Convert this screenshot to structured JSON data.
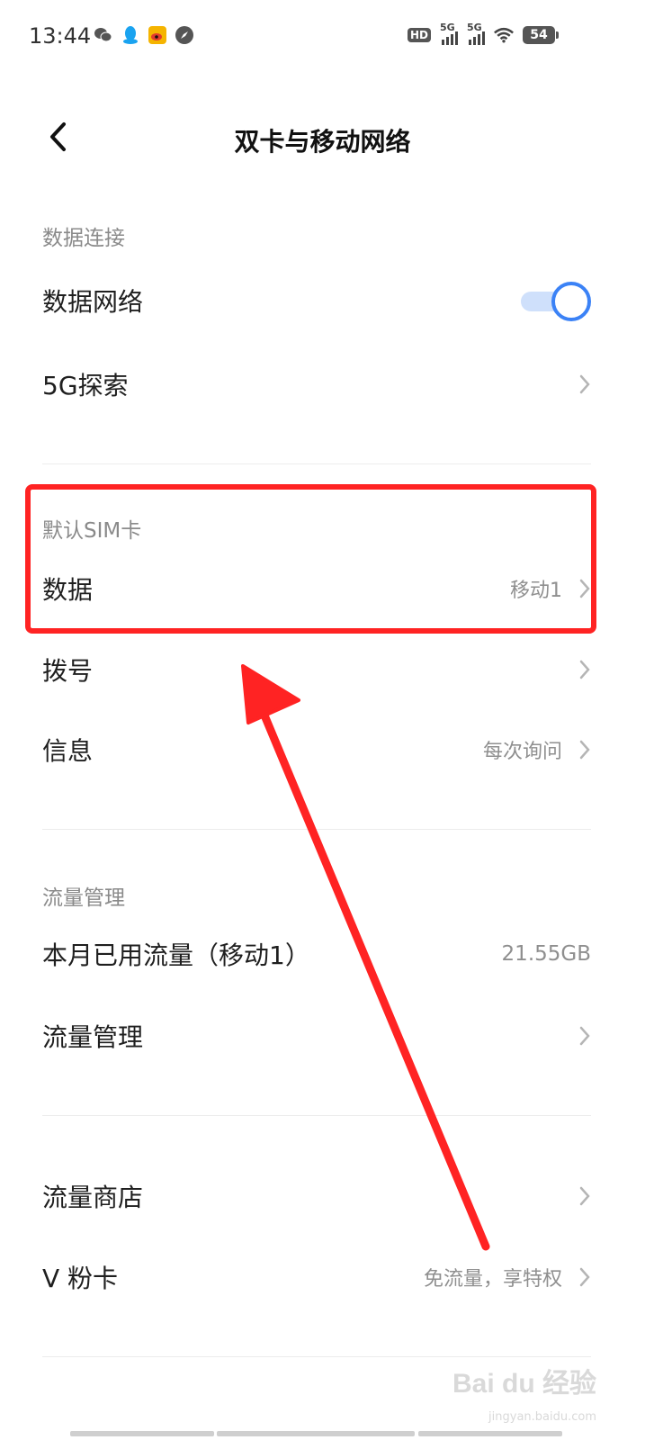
{
  "status_bar": {
    "time": "13:44",
    "battery": "54",
    "hd_label": "HD",
    "network1": "5G",
    "network2": "5G",
    "left_icons": [
      "wechat-icon",
      "qq-icon",
      "weibo-icon",
      "compass-icon"
    ]
  },
  "header": {
    "title": "双卡与移动网络"
  },
  "sections": {
    "data_connection": {
      "title": "数据连接",
      "data_network_label": "数据网络",
      "data_network_on": true,
      "fiveg_label": "5G探索"
    },
    "default_sim": {
      "title": "默认SIM卡",
      "data_label": "数据",
      "data_value": "移动1",
      "dial_label": "拨号",
      "message_label": "信息",
      "message_value": "每次询问"
    },
    "traffic_management": {
      "title": "流量管理",
      "monthly_label": "本月已用流量（移动1）",
      "monthly_value": "21.55GB",
      "manage_label": "流量管理"
    },
    "store": {
      "store_label": "流量商店",
      "vcard_label": "V 粉卡",
      "vcard_value": "免流量，享特权"
    }
  },
  "watermark": {
    "brand": "Bai du 经验",
    "url": "jingyan.baidu.com"
  },
  "colors": {
    "accent": "#3b82f6",
    "annotation": "#ff2323",
    "secondary_text": "#8f8f8f"
  }
}
